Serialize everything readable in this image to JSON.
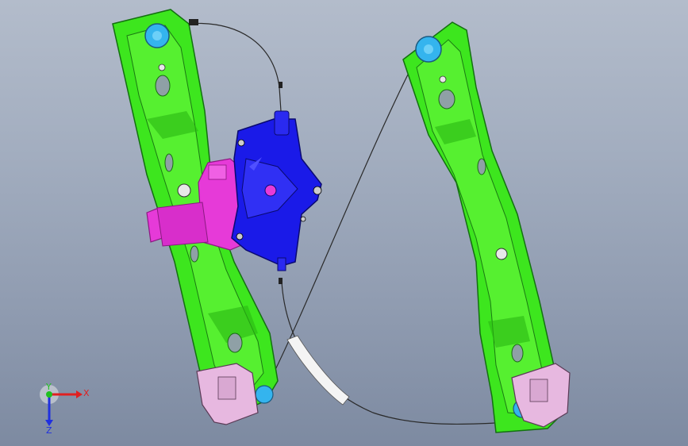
{
  "viewport": {
    "background_top": "#b3bccb",
    "background_bottom": "#7d8aa1"
  },
  "model": {
    "parts": [
      {
        "name": "left-guide-rail",
        "color": "#3de61e"
      },
      {
        "name": "right-guide-rail",
        "color": "#3de61e"
      },
      {
        "name": "motor-bracket",
        "color": "#1a1ae8"
      },
      {
        "name": "drive-motor",
        "color": "#e63ad8"
      },
      {
        "name": "cable-drum",
        "color": "#34b4ee"
      },
      {
        "name": "glass-carrier-clip",
        "color": "#e7b8e0"
      },
      {
        "name": "cable-sleeve",
        "color": "#f2f2f2"
      }
    ]
  },
  "triad": {
    "x_label": "X",
    "y_label": "Y",
    "z_label": "Z",
    "x_color": "#e02020",
    "y_color": "#20c020",
    "z_color": "#2030e0"
  }
}
